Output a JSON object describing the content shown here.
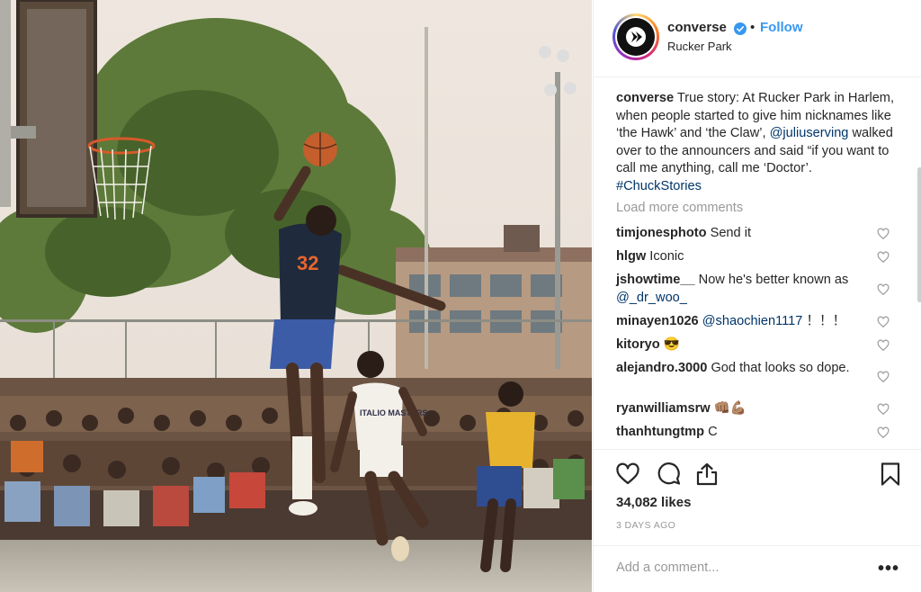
{
  "header": {
    "username": "converse",
    "separator": "•",
    "follow_label": "Follow",
    "location": "Rucker Park",
    "avatar_icon": "converse-star-chevron-logo",
    "verified_icon": "verified-badge-icon"
  },
  "caption": {
    "username": "converse",
    "text_part1": " True story: At Rucker Park in Harlem, when people started to give him nicknames like ‘the Hawk’ and ‘the Claw’, ",
    "mention": "@juliuserving",
    "text_part2": " walked over to the announcers and said “if you want to call me anything, call me ‘Doctor’. ",
    "hashtag": "#ChuckStories"
  },
  "load_more": "Load more comments",
  "comments": [
    {
      "user": "timjonesphoto",
      "text": " Send it"
    },
    {
      "user": "hlgw",
      "text": " Iconic"
    },
    {
      "user": "jshowtime__",
      "text": " Now he's better known as ",
      "mention": "@_dr_woo_"
    },
    {
      "user": "minayen1026",
      "mention": " @shaochien1117",
      "text": " ！！！"
    },
    {
      "user": "kitoryo",
      "text": " 😎"
    },
    {
      "user": "alejandro.3000",
      "text": " God that looks so dope."
    },
    {
      "user": "ryanwilliamsrw",
      "text": " 👊🏽💪🏽"
    },
    {
      "user": "thanhtungtmp",
      "text": " C"
    }
  ],
  "actions": {
    "likes": "34,082 likes",
    "posted": "3 DAYS AGO",
    "add_comment_placeholder": "Add a comment...",
    "more_label": "•••"
  },
  "colors": {
    "link": "#003569",
    "follow": "#3897f0",
    "muted": "#999999",
    "border": "#efefef"
  },
  "photo": {
    "jersey_front": "32",
    "jersey_defender": "ITALIO MASTERS"
  }
}
